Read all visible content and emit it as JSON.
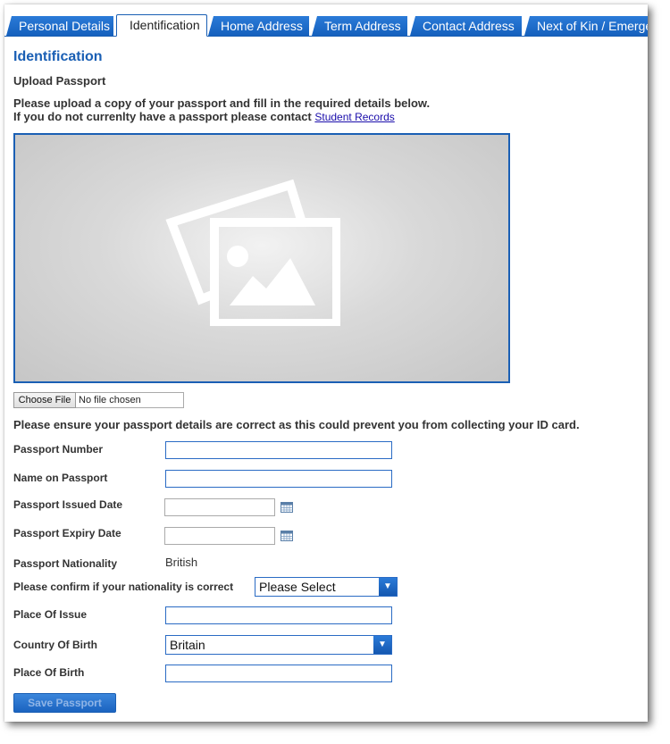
{
  "tabs": [
    {
      "label": "Personal Details",
      "active": false
    },
    {
      "label": "Identification",
      "active": true
    },
    {
      "label": "Home Address",
      "active": false
    },
    {
      "label": "Term Address",
      "active": false
    },
    {
      "label": "Contact Address",
      "active": false
    },
    {
      "label": "Next of Kin / Emergency",
      "active": false
    }
  ],
  "page": {
    "title": "Identification",
    "subtitle": "Upload Passport",
    "intro_line1": "Please upload a copy of your passport and fill in the required details below.",
    "intro_line2": "If you do not currenlty have a passport please contact",
    "intro_link": "Student Records",
    "image_placeholder_icon": "image-placeholder-icon"
  },
  "file_input": {
    "button_label": "Choose File",
    "status": "No file chosen"
  },
  "warning": "Please ensure your passport details are correct as this could prevent you from collecting your ID card.",
  "form": {
    "passport_number_label": "Passport Number",
    "passport_number_value": "",
    "name_on_passport_label": "Name on Passport",
    "name_on_passport_value": "",
    "issued_date_label": "Passport Issued Date",
    "issued_date_value": "",
    "expiry_date_label": "Passport Expiry Date",
    "expiry_date_value": "",
    "nationality_label": "Passport Nationality",
    "nationality_value": "British",
    "confirm_nationality_label": "Please confirm if your nationality is correct",
    "confirm_nationality_selected": "Please Select",
    "place_of_issue_label": "Place Of Issue",
    "place_of_issue_value": "",
    "country_of_birth_label": "Country Of Birth",
    "country_of_birth_selected": "Britain",
    "place_of_birth_label": "Place Of Birth",
    "place_of_birth_value": ""
  },
  "save_button": "Save Passport",
  "colors": {
    "accent": "#1a5fb4",
    "tab_bg": "#1560bd",
    "link": "#1a0dab"
  }
}
